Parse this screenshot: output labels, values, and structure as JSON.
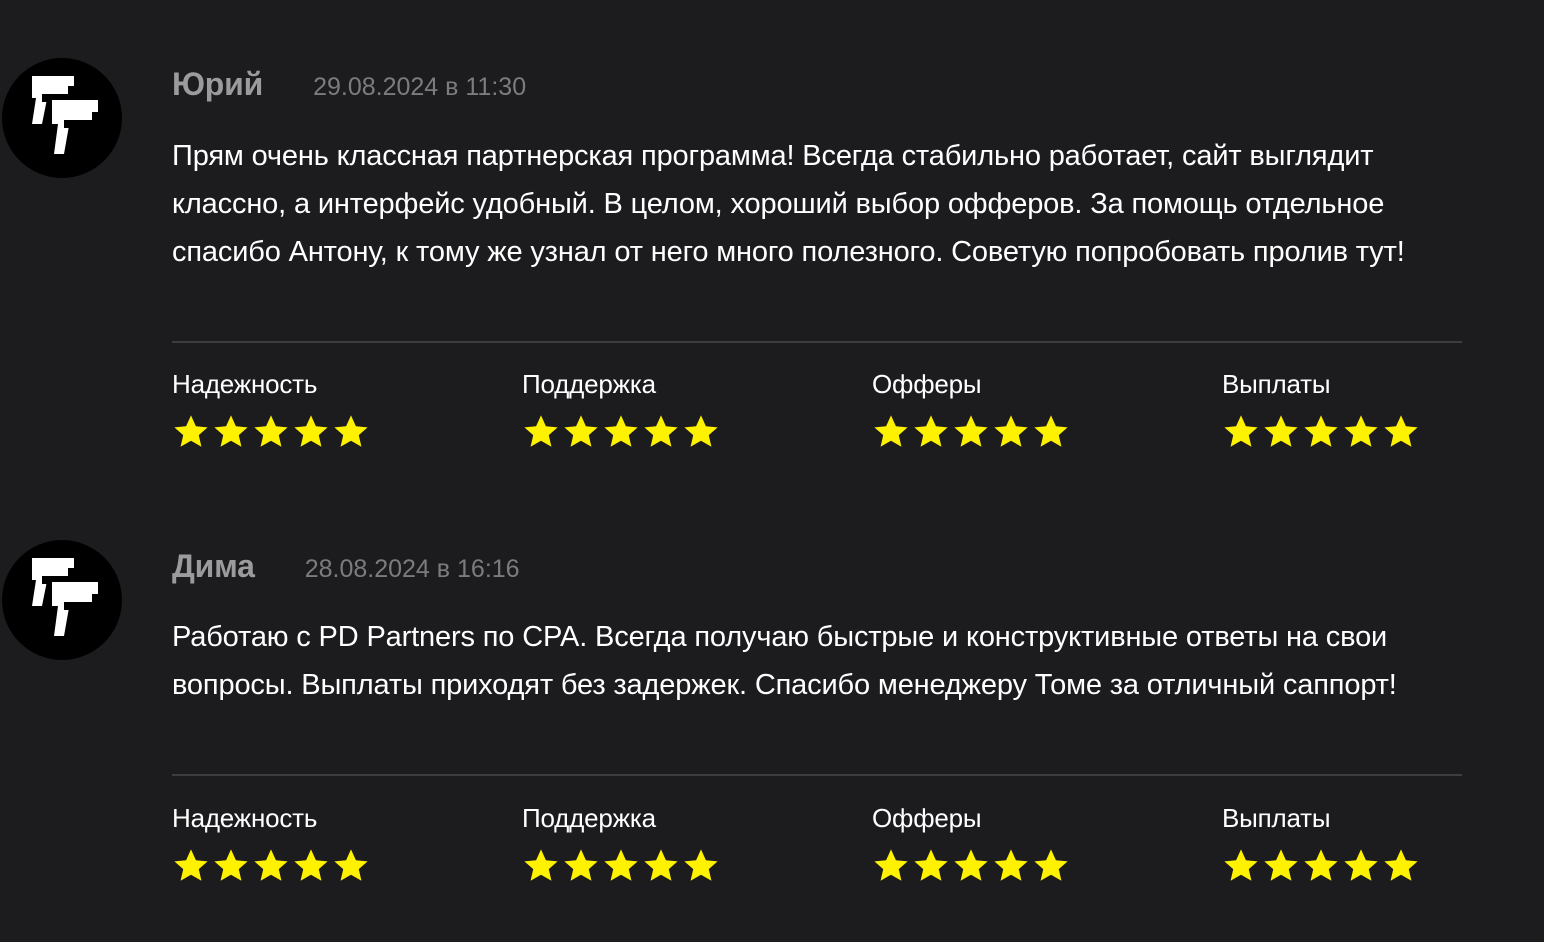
{
  "colors": {
    "background": "#1c1c1f",
    "author": "#9b9b9e",
    "date": "#7c7c80",
    "text": "#ffffff",
    "divider": "#3d3d41",
    "star": "#fff200",
    "avatar_bg": "#000000"
  },
  "avatar_icon": "pistols-logo-icon",
  "star_icon": "star-icon",
  "reviews": [
    {
      "author": "Юрий",
      "date": "29.08.2024 в 11:30",
      "text": "Прям очень классная партнерская программа! Всегда стабильно работает, сайт выглядит классно, а интерфейс удобный. В целом, хороший выбор офферов. За помощь отдельное спасибо Антону, к тому же узнал от него много полезного. Советую попробовать пролив тут!",
      "ratings": [
        {
          "label": "Надежность",
          "stars": 5,
          "max": 5
        },
        {
          "label": "Поддержка",
          "stars": 5,
          "max": 5
        },
        {
          "label": "Офферы",
          "stars": 5,
          "max": 5
        },
        {
          "label": "Выплаты",
          "stars": 5,
          "max": 5
        }
      ]
    },
    {
      "author": "Дима",
      "date": "28.08.2024 в 16:16",
      "text": "Работаю с PD Partners по CPA. Всегда получаю быстрые и конструктивные ответы на свои вопросы. Выплаты приходят без задержек. Спасибо менеджеру Томе за отличный саппорт!",
      "ratings": [
        {
          "label": "Надежность",
          "stars": 5,
          "max": 5
        },
        {
          "label": "Поддержка",
          "stars": 5,
          "max": 5
        },
        {
          "label": "Офферы",
          "stars": 5,
          "max": 5
        },
        {
          "label": "Выплаты",
          "stars": 5,
          "max": 5
        }
      ]
    }
  ]
}
